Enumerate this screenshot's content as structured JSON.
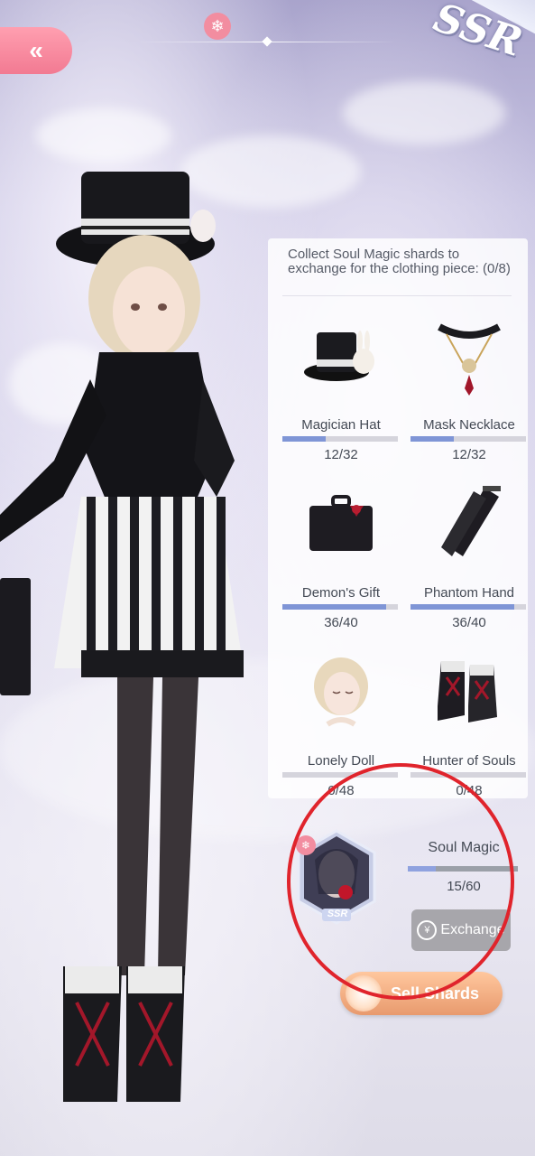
{
  "header": {
    "back_icon": "double-chevron-left-icon",
    "emblem_icon": "snowflake-emblem-icon",
    "rarity": "SSR"
  },
  "panel": {
    "title": "Collect Soul Magic shards to exchange for the clothing piece: (0/8)",
    "items": [
      {
        "name": "Magician Hat",
        "count": "12/32",
        "progress": 0.375,
        "icon": "top-hat-icon"
      },
      {
        "name": "Mask Necklace",
        "count": "12/32",
        "progress": 0.375,
        "icon": "necklace-icon"
      },
      {
        "name": "Demon's Gift",
        "count": "36/40",
        "progress": 0.9,
        "icon": "suitcase-icon"
      },
      {
        "name": "Phantom Hand",
        "count": "36/40",
        "progress": 0.9,
        "icon": "gloves-icon"
      },
      {
        "name": "Lonely Doll",
        "count": "0/48",
        "progress": 0.0,
        "icon": "doll-head-icon"
      },
      {
        "name": "Hunter of Souls",
        "count": "0/48",
        "progress": 0.0,
        "icon": "boots-icon"
      }
    ]
  },
  "soul_magic": {
    "card_rarity": "SSR",
    "name": "Soul Magic",
    "count": "15/60",
    "progress": 0.25,
    "exchange_label": "Exchange"
  },
  "sell_label": "Sell Shards",
  "colors": {
    "accent_pink": "#f27a92",
    "progress_fill": "#7f95d6",
    "annotation_red": "#e0242c",
    "sell_orange": "#e89a6e"
  }
}
